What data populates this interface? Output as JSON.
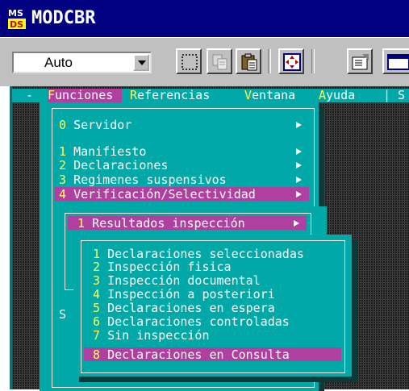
{
  "window": {
    "title": "MODCBR"
  },
  "toolbar": {
    "font_combo_value": "Auto"
  },
  "menubar": {
    "items": [
      {
        "label": "-"
      },
      {
        "label": "Funciones",
        "hotkey_index": 0
      },
      {
        "label": "Referencias",
        "hotkey_index": 0
      },
      {
        "label": "Ventana",
        "hotkey_index": 0
      },
      {
        "label": "Ayuda",
        "hotkey_index": 0
      },
      {
        "label": "| S"
      }
    ],
    "selected": "Funciones"
  },
  "menu_funciones": {
    "items": [
      {
        "num": "0",
        "label": "Servidor",
        "submenu": true
      },
      {
        "num": "1",
        "label": "Manifiesto",
        "submenu": true
      },
      {
        "num": "2",
        "label": "Declaraciones",
        "submenu": true
      },
      {
        "num": "3",
        "label": "Regimenes suspensivos",
        "submenu": true
      },
      {
        "num": "4",
        "label": "Verificación/Selectividad",
        "submenu": true,
        "highlighted": true
      }
    ],
    "bottom_letter": "S"
  },
  "menu_verificacion": {
    "items": [
      {
        "num": "1",
        "label": "Resultados inspección",
        "submenu": true,
        "highlighted": true
      }
    ]
  },
  "menu_resultados": {
    "items": [
      {
        "num": "1",
        "label": "Declaraciones seleccionadas"
      },
      {
        "num": "2",
        "label": "Inspección fisica"
      },
      {
        "num": "3",
        "label": "Inspección documental"
      },
      {
        "num": "4",
        "label": "Inspección a posteriori"
      },
      {
        "num": "5",
        "label": "Declaraciones en espera"
      },
      {
        "num": "6",
        "label": "Declaraciones controladas"
      },
      {
        "num": "7",
        "label": "Sin inspección"
      },
      {
        "num": "8",
        "label": "Declaraciones en Consulta",
        "highlighted": true
      }
    ]
  },
  "colors": {
    "titlebar": "#000080",
    "menu_bg": "#00a8a8",
    "highlight": "#b040a0",
    "hotkey": "#ffff55"
  }
}
